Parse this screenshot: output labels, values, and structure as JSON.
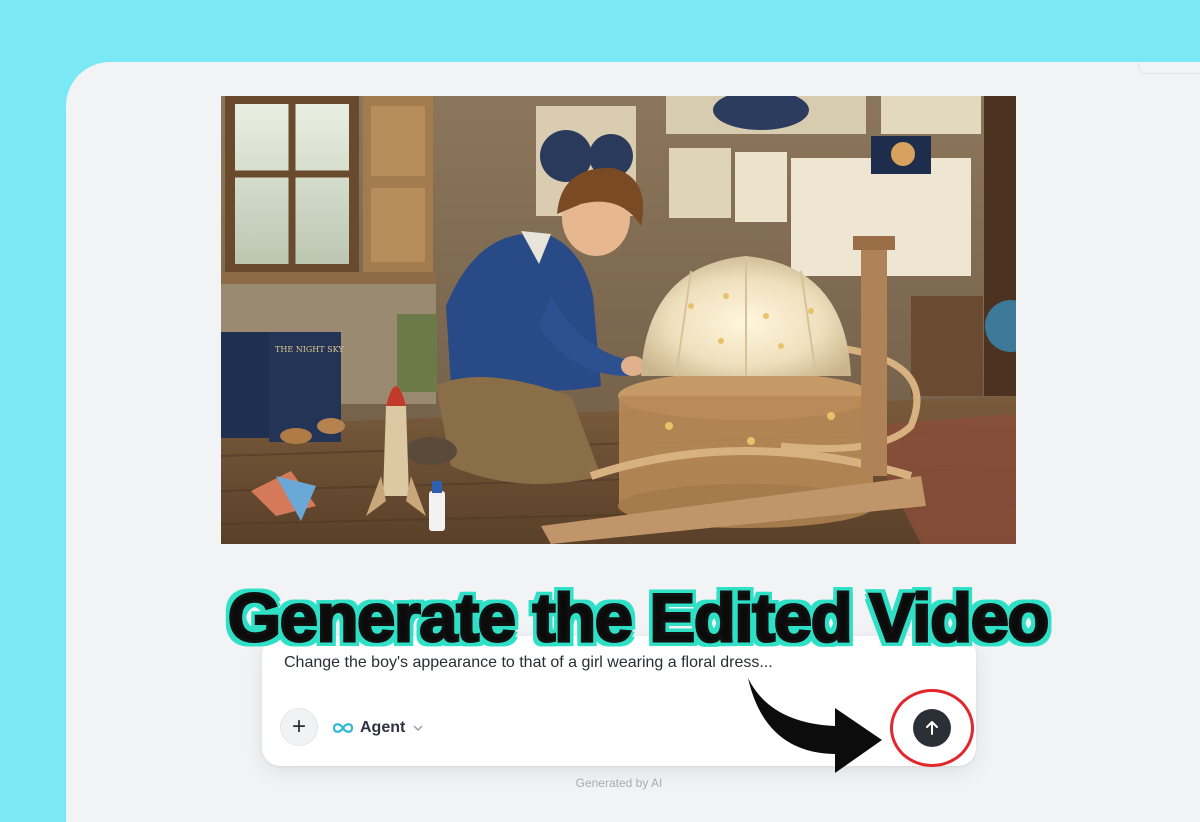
{
  "headline": "Generate the Edited Video",
  "prompt": {
    "text": "Change the boy's appearance to that of a girl wearing a floral dress...",
    "add_label": "+",
    "agent_label": "Agent",
    "agent_icon": "infinity-icon",
    "dropdown_icon": "chevron-down-icon",
    "send_icon": "arrow-up-icon"
  },
  "preview": {
    "book_title": "THE NIGHT SKY"
  },
  "footer": "Generated by AI",
  "colors": {
    "background": "#7be9f5",
    "panel": "#f2f3f5",
    "headline_outline": "#2fe0c6",
    "highlight_ring": "#e3262b",
    "send_button": "#2b2f36",
    "agent_accent": "#31b8d6"
  }
}
